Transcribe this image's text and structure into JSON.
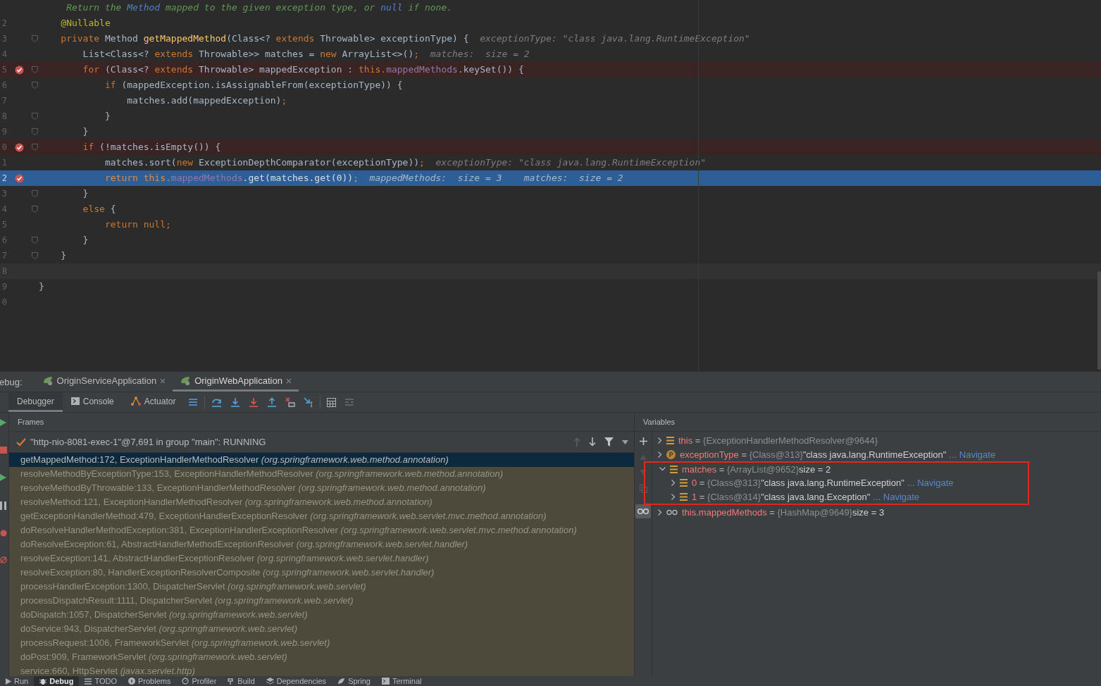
{
  "editor": {
    "lines": [
      {
        "kind": "plain",
        "breakpoint": false,
        "fold": false,
        "segs": [
          {
            "kind": "doc",
            "t": "     Return the "
          },
          {
            "kind": "doclink",
            "t": "Method"
          },
          {
            "kind": "doc",
            "t": " mapped to the given exception type, or "
          },
          {
            "kind": "doclink",
            "t": "null"
          },
          {
            "kind": "doc",
            "t": " if none."
          }
        ]
      },
      {
        "num": "2",
        "kind": "plain",
        "breakpoint": false,
        "fold": false,
        "segs": [
          {
            "kind": "ann",
            "t": "    @Nullable"
          }
        ]
      },
      {
        "num": "3",
        "kind": "plain",
        "breakpoint": false,
        "fold": true,
        "segs": [
          {
            "kind": "kw",
            "t": "    private "
          },
          {
            "kind": "plain",
            "t": "Method "
          },
          {
            "kind": "fn",
            "t": "getMappedMethod"
          },
          {
            "kind": "plain",
            "t": "(Class<? "
          },
          {
            "kind": "kw",
            "t": "extends "
          },
          {
            "kind": "plain",
            "t": "Throwable> exceptionType) {  "
          },
          {
            "kind": "hint",
            "t": "exceptionType: \"class java.lang.RuntimeException\""
          }
        ]
      },
      {
        "num": "4",
        "kind": "plain",
        "breakpoint": false,
        "fold": false,
        "segs": [
          {
            "kind": "plain",
            "t": "        List<Class<? "
          },
          {
            "kind": "kw",
            "t": "extends "
          },
          {
            "kind": "plain",
            "t": "Throwable>> matches = "
          },
          {
            "kind": "kw",
            "t": "new "
          },
          {
            "kind": "plain",
            "t": "ArrayList<>()"
          },
          {
            "kind": "kw",
            "t": ";"
          },
          {
            "kind": "hint",
            "t": "  matches:  size = 2"
          }
        ]
      },
      {
        "num": "5",
        "kind": "breakpoint",
        "breakpoint": true,
        "fold": true,
        "segs": [
          {
            "kind": "kw",
            "t": "        for "
          },
          {
            "kind": "plain",
            "t": "(Class<? "
          },
          {
            "kind": "kw",
            "t": "extends "
          },
          {
            "kind": "plain",
            "t": "Throwable> mappedException : "
          },
          {
            "kind": "kw",
            "t": "this."
          },
          {
            "kind": "field",
            "t": "mappedMethods"
          },
          {
            "kind": "plain",
            "t": ".keySet()) {"
          }
        ]
      },
      {
        "num": "6",
        "kind": "plain",
        "breakpoint": false,
        "fold": true,
        "segs": [
          {
            "kind": "kw",
            "t": "            if "
          },
          {
            "kind": "plain",
            "t": "(mappedException.isAssignableFrom(exceptionType)) {"
          }
        ]
      },
      {
        "num": "7",
        "kind": "plain",
        "breakpoint": false,
        "fold": false,
        "segs": [
          {
            "kind": "plain",
            "t": "                matches.add(mappedException)"
          },
          {
            "kind": "kw",
            "t": ";"
          }
        ]
      },
      {
        "num": "8",
        "kind": "plain",
        "breakpoint": false,
        "fold": true,
        "segs": [
          {
            "kind": "plain",
            "t": "            }"
          }
        ]
      },
      {
        "num": "9",
        "kind": "plain",
        "breakpoint": false,
        "fold": true,
        "segs": [
          {
            "kind": "plain",
            "t": "        }"
          }
        ]
      },
      {
        "num": "0",
        "kind": "breakpoint",
        "breakpoint": true,
        "fold": true,
        "segs": [
          {
            "kind": "kw",
            "t": "        if "
          },
          {
            "kind": "plain",
            "t": "(!matches.isEmpty()) {"
          }
        ]
      },
      {
        "num": "1",
        "kind": "plain",
        "breakpoint": false,
        "fold": false,
        "segs": [
          {
            "kind": "plain",
            "t": "            matches.sort("
          },
          {
            "kind": "kw",
            "t": "new "
          },
          {
            "kind": "plain",
            "t": "ExceptionDepthComparator(exceptionType))"
          },
          {
            "kind": "kw",
            "t": ";"
          },
          {
            "kind": "hint",
            "t": "  exceptionType: \"class java.lang.RuntimeException\""
          }
        ]
      },
      {
        "num": "2",
        "kind": "execution",
        "breakpoint": true,
        "fold": false,
        "segs": [
          {
            "kind": "kw",
            "t": "            return this."
          },
          {
            "kind": "field",
            "t": "mappedMethods"
          },
          {
            "kind": "plain",
            "t": ".get(matches.get("
          },
          {
            "kind": "num",
            "t": "0"
          },
          {
            "kind": "plain",
            "t": "))"
          },
          {
            "kind": "kw",
            "t": ";"
          },
          {
            "kind": "hint",
            "t": "  mappedMethods:  size = 3    matches:  size = 2"
          }
        ]
      },
      {
        "num": "3",
        "kind": "plain",
        "breakpoint": false,
        "fold": true,
        "segs": [
          {
            "kind": "plain",
            "t": "        }"
          }
        ]
      },
      {
        "num": "4",
        "kind": "plain",
        "breakpoint": false,
        "fold": true,
        "segs": [
          {
            "kind": "kw",
            "t": "        else "
          },
          {
            "kind": "plain",
            "t": "{"
          }
        ]
      },
      {
        "num": "5",
        "kind": "plain",
        "breakpoint": false,
        "fold": false,
        "segs": [
          {
            "kind": "kw",
            "t": "            return null;"
          }
        ]
      },
      {
        "num": "6",
        "kind": "plain",
        "breakpoint": false,
        "fold": true,
        "segs": [
          {
            "kind": "plain",
            "t": "        }"
          }
        ]
      },
      {
        "num": "7",
        "kind": "plain",
        "breakpoint": false,
        "fold": true,
        "segs": [
          {
            "kind": "plain",
            "t": "    }"
          }
        ]
      },
      {
        "num": "8",
        "kind": "caret",
        "breakpoint": false,
        "fold": false
      },
      {
        "num": "9",
        "kind": "plain",
        "breakpoint": false,
        "fold": false,
        "segs": [
          {
            "kind": "plain",
            "t": "}"
          }
        ]
      },
      {
        "num": "0",
        "kind": "plain",
        "breakpoint": false,
        "fold": false
      }
    ]
  },
  "debug": {
    "label": "ebug:",
    "sessions": [
      {
        "name": "OriginServiceApplication",
        "selected": false
      },
      {
        "name": "OriginWebApplication",
        "selected": true
      }
    ],
    "tabs": [
      {
        "label": "Debugger",
        "kind": "debugger",
        "selected": true
      },
      {
        "label": "Console",
        "kind": "console",
        "selected": false
      },
      {
        "label": "Actuator",
        "kind": "actuator",
        "selected": false
      }
    ]
  },
  "frames": {
    "title": "Frames",
    "thread": "\"http-nio-8081-exec-1\"@7,691 in group \"main\": RUNNING",
    "items": [
      {
        "location": "getMappedMethod:172, ExceptionHandlerMethodResolver",
        "package": "(org.springframework.web.method.annotation)",
        "selected": true
      },
      {
        "location": "resolveMethodByExceptionType:153, ExceptionHandlerMethodResolver",
        "package": "(org.springframework.web.method.annotation)",
        "selected": false
      },
      {
        "location": "resolveMethodByThrowable:133, ExceptionHandlerMethodResolver",
        "package": "(org.springframework.web.method.annotation)",
        "selected": false
      },
      {
        "location": "resolveMethod:121, ExceptionHandlerMethodResolver",
        "package": "(org.springframework.web.method.annotation)",
        "selected": false
      },
      {
        "location": "getExceptionHandlerMethod:479, ExceptionHandlerExceptionResolver",
        "package": "(org.springframework.web.servlet.mvc.method.annotation)",
        "selected": false
      },
      {
        "location": "doResolveHandlerMethodException:381, ExceptionHandlerExceptionResolver",
        "package": "(org.springframework.web.servlet.mvc.method.annotation)",
        "selected": false
      },
      {
        "location": "doResolveException:61, AbstractHandlerMethodExceptionResolver",
        "package": "(org.springframework.web.servlet.handler)",
        "selected": false
      },
      {
        "location": "resolveException:141, AbstractHandlerExceptionResolver",
        "package": "(org.springframework.web.servlet.handler)",
        "selected": false
      },
      {
        "location": "resolveException:80, HandlerExceptionResolverComposite",
        "package": "(org.springframework.web.servlet.handler)",
        "selected": false
      },
      {
        "location": "processHandlerException:1300, DispatcherServlet",
        "package": "(org.springframework.web.servlet)",
        "selected": false
      },
      {
        "location": "processDispatchResult:1111, DispatcherServlet",
        "package": "(org.springframework.web.servlet)",
        "selected": false
      },
      {
        "location": "doDispatch:1057, DispatcherServlet",
        "package": "(org.springframework.web.servlet)",
        "selected": false
      },
      {
        "location": "doService:943, DispatcherServlet",
        "package": "(org.springframework.web.servlet)",
        "selected": false
      },
      {
        "location": "processRequest:1006, FrameworkServlet",
        "package": "(org.springframework.web.servlet)",
        "selected": false
      },
      {
        "location": "doPost:909, FrameworkServlet",
        "package": "(org.springframework.web.servlet)",
        "selected": false
      },
      {
        "location": "service:660, HttpServlet",
        "package": "(javax.servlet.http)",
        "selected": false
      }
    ]
  },
  "variables": {
    "title": "Variables",
    "items": [
      {
        "kind": "field",
        "name": "this",
        "eq": "=",
        "ref": "{ExceptionHandlerMethodResolver@9644}",
        "expanded": false,
        "highlighted": false
      },
      {
        "kind": "param",
        "name": "exceptionType",
        "eq": "=",
        "ref": "{Class@313}",
        "value": "\"class java.lang.RuntimeException\"",
        "navigate": "... Navigate",
        "expanded": false,
        "highlighted": false
      },
      {
        "kind": "field",
        "name": "matches",
        "eq": "=",
        "ref": "{ArrayList@9652}",
        "value": "size = 2",
        "expanded": true,
        "highlighted": true,
        "children": [
          {
            "kind": "field",
            "name": "0",
            "eq": "=",
            "ref": "{Class@313}",
            "value": "\"class java.lang.RuntimeException\"",
            "navigate": "... Navigate",
            "expanded": false,
            "highlighted": false
          },
          {
            "kind": "field",
            "name": "1",
            "eq": "=",
            "ref": "{Class@314}",
            "value": "\"class java.lang.Exception\"",
            "navigate": "... Navigate",
            "expanded": false,
            "highlighted": false
          }
        ]
      },
      {
        "kind": "watch",
        "name": "this.mappedMethods",
        "eq": "=",
        "ref": "{HashMap@9649}",
        "value": "size = 3",
        "expanded": false,
        "highlighted": false
      }
    ]
  },
  "bottom_bar": [
    {
      "label": "Run",
      "kind": "run",
      "selected": false
    },
    {
      "label": "Debug",
      "kind": "debug",
      "selected": true
    },
    {
      "label": "TODO",
      "kind": "todo",
      "selected": false
    },
    {
      "label": "Problems",
      "kind": "problems",
      "selected": false
    },
    {
      "label": "Profiler",
      "kind": "profiler",
      "selected": false
    },
    {
      "label": "Build",
      "kind": "build",
      "selected": false
    },
    {
      "label": "Dependencies",
      "kind": "dependencies",
      "selected": false
    },
    {
      "label": "Spring",
      "kind": "spring",
      "selected": false
    },
    {
      "label": "Terminal",
      "kind": "terminal",
      "selected": false
    }
  ]
}
